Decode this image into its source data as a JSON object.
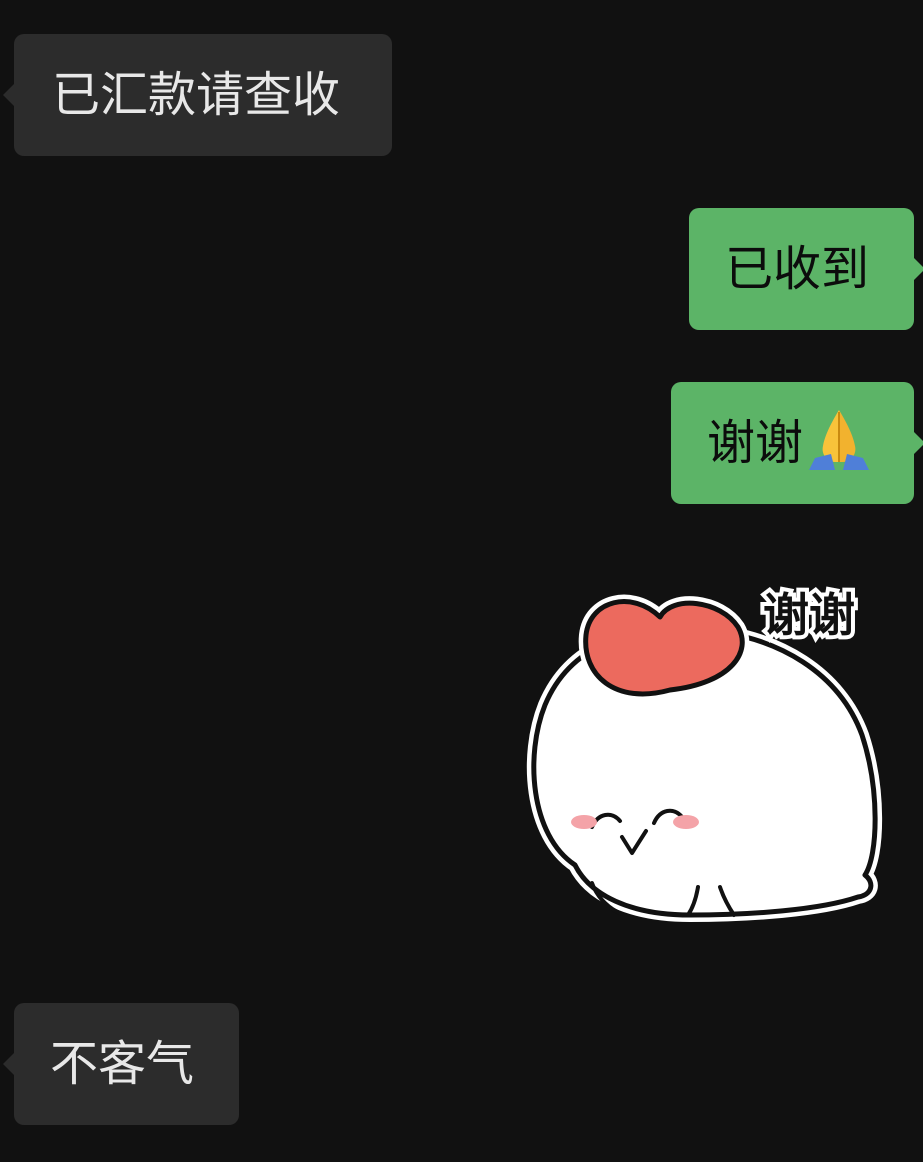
{
  "messages": [
    {
      "side": "incoming",
      "text": "已汇款请查收"
    },
    {
      "side": "outgoing",
      "text": "已收到"
    },
    {
      "side": "outgoing",
      "text": "谢谢",
      "emoji": "folded-hands-icon"
    },
    {
      "side": "outgoing",
      "type": "sticker",
      "sticker_text": "谢谢",
      "sticker": "heart-mochi-sticker"
    },
    {
      "side": "incoming",
      "text": "不客气"
    }
  ],
  "colors": {
    "background": "#111111",
    "incoming_bubble": "#2c2c2c",
    "outgoing_bubble": "#5cb467",
    "heart": "#ec6a5e"
  }
}
